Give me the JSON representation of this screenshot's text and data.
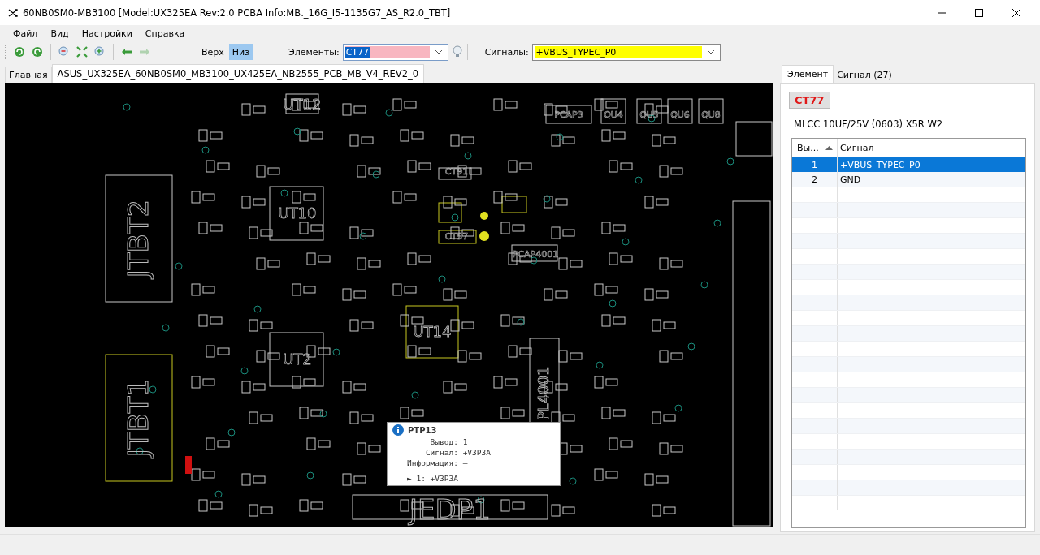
{
  "window": {
    "title": "60NB0SM0-MB3100 [Model:UX325EA Rev:2.0 PCBA Info:MB._16G_I5-1135G7_AS_R2.0_TBT]"
  },
  "menu": [
    "Файл",
    "Вид",
    "Настройки",
    "Справка"
  ],
  "toolbar": {
    "tools": [
      {
        "kind": "reload",
        "disabled": false
      },
      {
        "kind": "refresh",
        "disabled": false
      },
      {
        "kind": "zoom-out",
        "disabled": false
      },
      {
        "kind": "fit",
        "disabled": false
      },
      {
        "kind": "zoom-in",
        "disabled": false
      },
      {
        "kind": "back",
        "disabled": false
      },
      {
        "kind": "forward",
        "disabled": true
      }
    ],
    "sides": [
      {
        "label": "Верх",
        "selected": false
      },
      {
        "label": "Низ",
        "selected": true
      }
    ],
    "elements_label": "Элементы:",
    "elements_value": "CT77",
    "signals_label": "Сигналы:",
    "signals_value": "+VBUS_TYPEC_P0"
  },
  "doc_tabs": [
    {
      "label": "Главная",
      "selected": false
    },
    {
      "label": "ASUS_UX325EA_60NB0SM0_MB3100_UX425EA_NB2555_PCB_MB_V4_REV2_0",
      "selected": true
    }
  ],
  "board": {
    "labels": [
      "UT12",
      "PCAP3",
      "QU4",
      "QU5",
      "QU6",
      "QU8",
      "CT91",
      "UT10",
      "CT57",
      "JTBT2",
      "PCAP4001",
      "UT14",
      "UT2",
      "PL4001",
      "JTBT1",
      "JEDP1"
    ]
  },
  "tooltip": {
    "title": "PTP13",
    "lines": [
      "     Вывод: 1",
      "    Сигнал: +V3P3A",
      "Информация: —"
    ],
    "footer": "► 1: +V3P3A"
  },
  "panel": {
    "tabs": [
      {
        "label": "Элемент",
        "selected": true
      },
      {
        "label": "Сигнал (27)",
        "selected": false
      }
    ],
    "element": "CT77",
    "description": "MLCC 10UF/25V (0603) X5R W2",
    "columns": [
      "Вы...",
      "Сигнал"
    ],
    "rows": [
      {
        "pin": "1",
        "signal": "+VBUS_TYPEC_P0",
        "selected": true
      },
      {
        "pin": "2",
        "signal": "GND",
        "selected": false
      }
    ]
  }
}
